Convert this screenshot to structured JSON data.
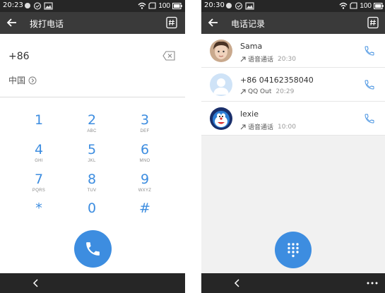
{
  "left": {
    "status": {
      "time": "20:23",
      "battery": "100"
    },
    "toolbar": {
      "title": "拨打电话"
    },
    "dialer": {
      "number": "+86",
      "country": "中国",
      "keys": [
        {
          "digit": "1",
          "letters": ""
        },
        {
          "digit": "2",
          "letters": "ABC"
        },
        {
          "digit": "3",
          "letters": "DEF"
        },
        {
          "digit": "4",
          "letters": "GHI"
        },
        {
          "digit": "5",
          "letters": "JKL"
        },
        {
          "digit": "6",
          "letters": "MNO"
        },
        {
          "digit": "7",
          "letters": "PQRS"
        },
        {
          "digit": "8",
          "letters": "TUV"
        },
        {
          "digit": "9",
          "letters": "WXYZ"
        },
        {
          "digit": "*",
          "letters": ""
        },
        {
          "digit": "0",
          "letters": ""
        },
        {
          "digit": "#",
          "letters": ""
        }
      ]
    }
  },
  "right": {
    "status": {
      "time": "20:30",
      "battery": "100"
    },
    "toolbar": {
      "title": "电话记录"
    },
    "calls": [
      {
        "name": "Sama",
        "type": "语音通话",
        "time": "20:30",
        "avatar": "photo-avatar"
      },
      {
        "name": "+86 04162358040",
        "type": "QQ Out",
        "time": "20:29",
        "avatar": "default-avatar"
      },
      {
        "name": "lexie",
        "type": "语音通话",
        "time": "10:00",
        "avatar": "doraemon-avatar"
      }
    ]
  },
  "colors": {
    "accent": "#3d8de0",
    "toolbar": "#3a3a3a",
    "statusbar": "#262626"
  }
}
